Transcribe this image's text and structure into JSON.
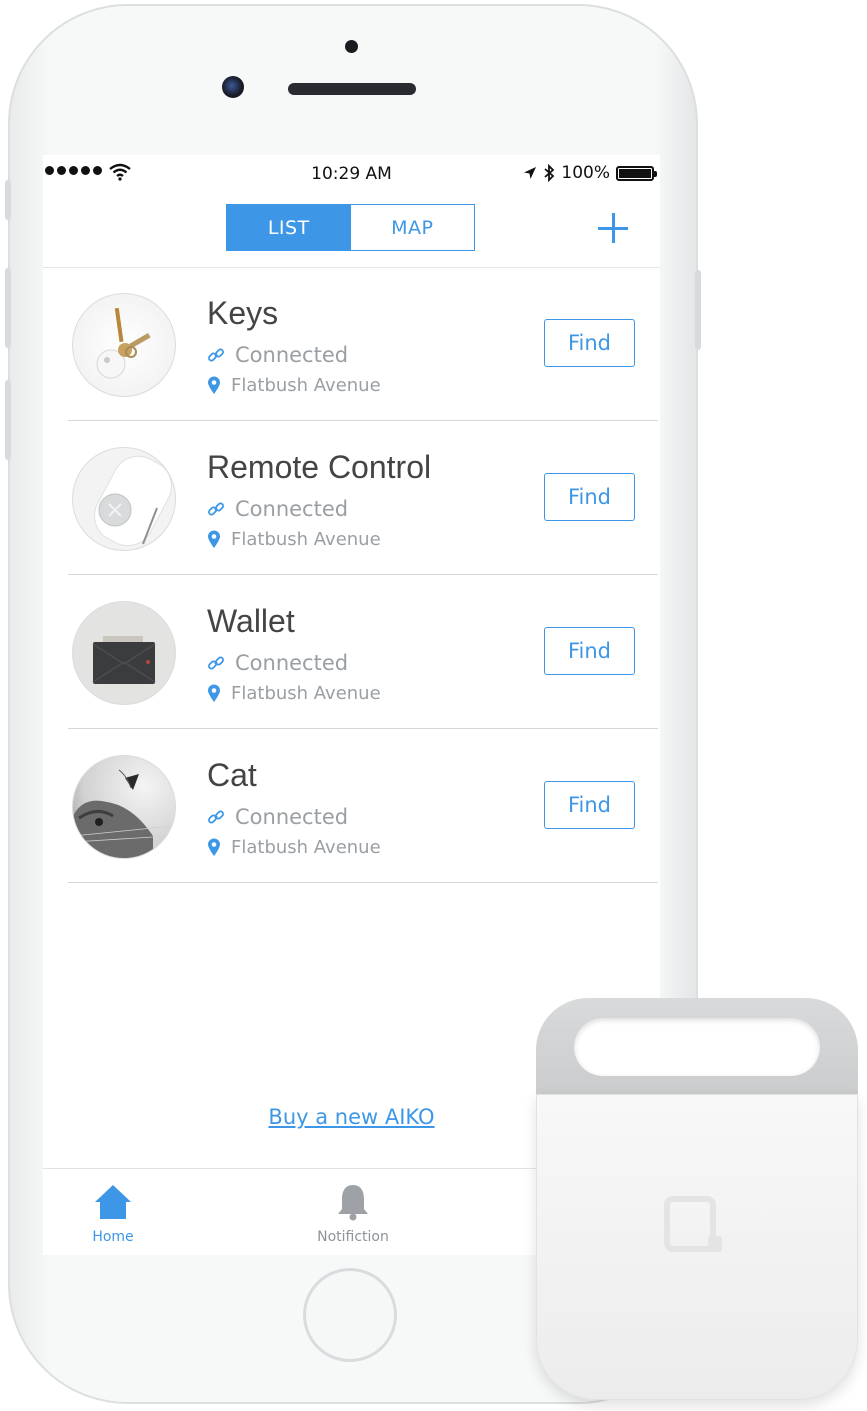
{
  "status_bar": {
    "time": "10:29 AM",
    "battery": "100%"
  },
  "header": {
    "tabs": [
      {
        "label": "LIST",
        "active": true
      },
      {
        "label": "MAP",
        "active": false
      }
    ],
    "add_icon": "plus-icon"
  },
  "items": [
    {
      "name": "Keys",
      "status": "Connected",
      "location": "Flatbush Avenue",
      "action": "Find"
    },
    {
      "name": "Remote Control",
      "status": "Connected",
      "location": "Flatbush Avenue",
      "action": "Find"
    },
    {
      "name": "Wallet",
      "status": "Connected",
      "location": "Flatbush Avenue",
      "action": "Find"
    },
    {
      "name": "Cat",
      "status": "Connected",
      "location": "Flatbush Avenue",
      "action": "Find"
    }
  ],
  "buy_link": "Buy a new AIKO",
  "tabbar": [
    {
      "label": "Home",
      "icon": "home-icon",
      "active": true
    },
    {
      "label": "Notifiction",
      "icon": "bell-icon",
      "active": false
    }
  ],
  "colors": {
    "accent": "#3d97e6",
    "muted": "#9a9fa4",
    "title": "#444444"
  }
}
